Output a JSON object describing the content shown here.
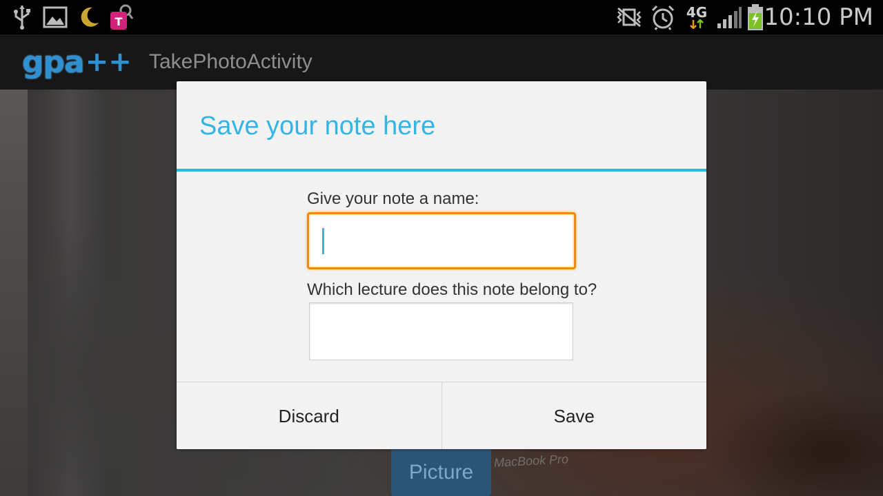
{
  "status_bar": {
    "time": "10:10 PM",
    "network_type": "4G",
    "left_icons": [
      "usb-icon",
      "image-icon",
      "moon-icon",
      "t-mobile-icon"
    ],
    "right_icons": [
      "vibrate-icon",
      "alarm-icon",
      "network-4g-icon",
      "signal-icon",
      "battery-charging-icon"
    ]
  },
  "action_bar": {
    "logo_text": "gpa",
    "logo_plus": "++",
    "title": "TakePhotoActivity"
  },
  "background": {
    "picture_button_label": "Picture",
    "laptop_text": "MacBook Pro"
  },
  "dialog": {
    "title": "Save your note here",
    "name_label": "Give your note a name:",
    "name_value": "",
    "lecture_label": "Which lecture does this note belong to?",
    "lecture_value": "",
    "discard_label": "Discard",
    "save_label": "Save"
  },
  "colors": {
    "accent": "#33b5e5",
    "focus": "#f0890e",
    "status_bar": "#000000",
    "action_bar": "#171717"
  }
}
